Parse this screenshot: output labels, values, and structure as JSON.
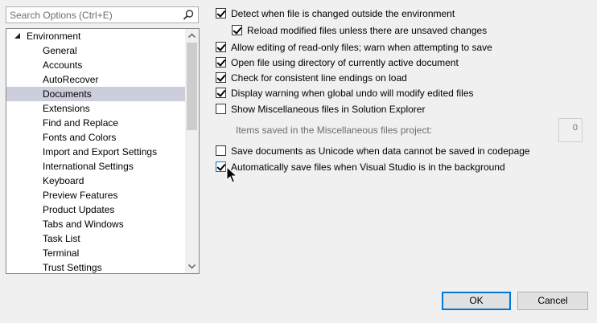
{
  "search": {
    "placeholder": "Search Options (Ctrl+E)",
    "icon": "search-icon"
  },
  "tree": {
    "parent": {
      "label": "Environment",
      "expanded": true
    },
    "items": [
      {
        "label": "General"
      },
      {
        "label": "Accounts"
      },
      {
        "label": "AutoRecover"
      },
      {
        "label": "Documents",
        "selected": true
      },
      {
        "label": "Extensions"
      },
      {
        "label": "Find and Replace"
      },
      {
        "label": "Fonts and Colors"
      },
      {
        "label": "Import and Export Settings"
      },
      {
        "label": "International Settings"
      },
      {
        "label": "Keyboard"
      },
      {
        "label": "Preview Features"
      },
      {
        "label": "Product Updates"
      },
      {
        "label": "Tabs and Windows"
      },
      {
        "label": "Task List"
      },
      {
        "label": "Terminal"
      },
      {
        "label": "Trust Settings"
      }
    ]
  },
  "options": [
    {
      "label": "Detect when file is changed outside the environment",
      "checked": true
    },
    {
      "label": "Reload modified files unless there are unsaved changes",
      "checked": true
    },
    {
      "label": "Allow editing of read-only files; warn when attempting to save",
      "checked": true
    },
    {
      "label": "Open file using directory of currently active document",
      "checked": true
    },
    {
      "label": "Check for consistent line endings on load",
      "checked": true
    },
    {
      "label": "Display warning when global undo will modify edited files",
      "checked": true
    },
    {
      "label": "Show Miscellaneous files in Solution Explorer",
      "checked": false
    },
    {
      "label": "Save documents as Unicode when data cannot be saved in codepage",
      "checked": false
    },
    {
      "label": "Automatically save files when Visual Studio is in the background",
      "checked": true
    }
  ],
  "misc": {
    "label": "Items saved in the Miscellaneous files project:",
    "value": "0"
  },
  "buttons": {
    "ok": "OK",
    "cancel": "Cancel"
  },
  "colors": {
    "selection": "#cccedb",
    "accent": "#0078d7"
  }
}
